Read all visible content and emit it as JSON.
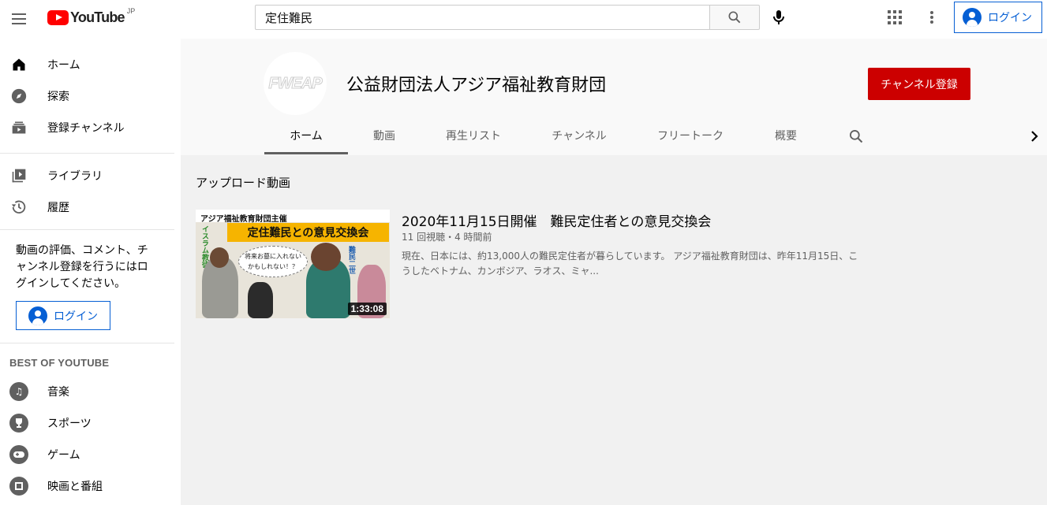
{
  "header": {
    "logo_text": "YouTube",
    "logo_region": "JP",
    "search_value": "定住難民",
    "login_label": "ログイン"
  },
  "sidebar": {
    "items_primary": [
      {
        "label": "ホーム",
        "icon": "home-icon"
      },
      {
        "label": "探索",
        "icon": "explore-icon"
      },
      {
        "label": "登録チャンネル",
        "icon": "subscriptions-icon"
      }
    ],
    "items_secondary": [
      {
        "label": "ライブラリ",
        "icon": "library-icon"
      },
      {
        "label": "履歴",
        "icon": "history-icon"
      }
    ],
    "signin_message": "動画の評価、コメント、チャンネル登録を行うにはログインしてください。",
    "login_label": "ログイン",
    "section_title": "BEST OF YOUTUBE",
    "best_items": [
      {
        "label": "音楽",
        "icon": "music-icon"
      },
      {
        "label": "スポーツ",
        "icon": "trophy-icon"
      },
      {
        "label": "ゲーム",
        "icon": "gaming-icon"
      },
      {
        "label": "映画と番組",
        "icon": "movies-icon"
      }
    ]
  },
  "channel": {
    "avatar_text": "FWEAP",
    "name": "公益財団法人アジア福祉教育財団",
    "subscribe_label": "チャンネル登録",
    "tabs": [
      "ホーム",
      "動画",
      "再生リスト",
      "チャンネル",
      "フリートーク",
      "概要"
    ],
    "active_tab": "ホーム"
  },
  "uploads": {
    "section_title": "アップロード動画",
    "video": {
      "title": "2020年11月15日開催　難民定住者との意見交換会",
      "meta": "11 回視聴・4 時間前",
      "description": "現在、日本には、約13,000人の難民定住者が暮らしています。 アジア福祉教育財団は、昨年11月15日、こうしたベトナム、カンボジア、ラオス、ミャ...",
      "duration": "1:33:08",
      "thumbnail": {
        "top_text": "アジア福祉教育財団主催",
        "banner_text": "定住難民との意見交換会",
        "side_left": "イスラム教徒",
        "bubble_line1": "将来お墓に入れない",
        "bubble_line2": "かもしれない！？",
        "side_right": "難民二世"
      }
    }
  },
  "colors": {
    "accent_blue": "#065fd4",
    "subscribe_red": "#cc0000",
    "logo_red": "#ff0000",
    "thumb_banner": "#f6b400"
  }
}
